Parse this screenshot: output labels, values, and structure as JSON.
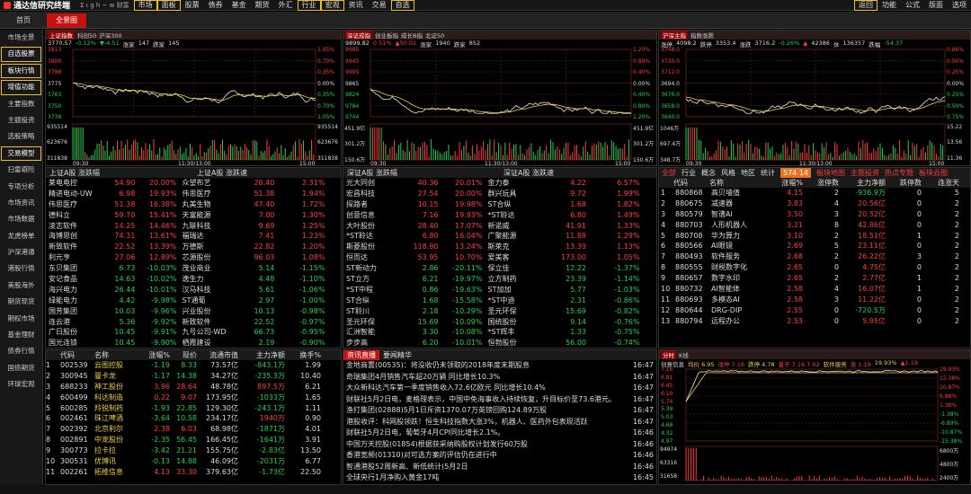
{
  "topbar": {
    "app": "通达信研究终端",
    "logo_text": "Σ ι g h ~ w 财富",
    "menu": [
      "市场",
      "面板",
      "股票",
      "债券",
      "基金",
      "期货",
      "外汇",
      "行业",
      "宏观",
      "资讯",
      "交易",
      "自选"
    ],
    "right_menu": [
      "返回",
      "功能",
      "公式",
      "版面",
      "选项"
    ]
  },
  "tabs": [
    "首页",
    "全景图"
  ],
  "sidebar": [
    "市场全景",
    "自选股票",
    "板块行情",
    "增值功能",
    "主要指数",
    "主题投资",
    "选股策略",
    "交易模型",
    "扫雷避险",
    "专项分析",
    "市场资讯",
    "市场数据",
    "龙虎榜单",
    "沪深港通",
    "港股行情",
    "美股海外",
    "期货现货",
    "期权市场",
    "基金理财",
    "债券行情",
    "国债期货",
    "环球宏观"
  ],
  "indices": [
    {
      "tabs": [
        "上证指数",
        "科创50",
        "沪深300"
      ],
      "info": [
        "3770.57",
        "-0.12%",
        "▼-4.51",
        "涨家",
        "147",
        "跌家",
        "145"
      ],
      "left_ticks": [
        "3813",
        "3800",
        "3788",
        "3775",
        "3763",
        "3750",
        "3738"
      ],
      "right_ticks": [
        "1.05%",
        "0.70%",
        "0.35%",
        "0.00%",
        "0.35%",
        "0.70%",
        "1.05%"
      ],
      "vol_left": [
        "935514",
        "623676",
        "311838"
      ],
      "vol_right": [
        "935514",
        "623676",
        "311838"
      ],
      "x_ticks": [
        "09:30",
        "11:30/13:00",
        "15:00"
      ]
    },
    {
      "tabs": [
        "深证成指",
        "创业板指",
        "成长B指",
        "北证50"
      ],
      "info": [
        "9899.82",
        "0.51%",
        "▲50.02",
        "涨家",
        "1940",
        "跌家",
        "852"
      ],
      "left_ticks": [
        "9985",
        "9945",
        "9905",
        "9865",
        "9824",
        "9784",
        "9744"
      ],
      "right_ticks": [
        "1.20%",
        "0.80%",
        "0.40%",
        "0.00%",
        "0.40%",
        "0.80%",
        "1.20%"
      ],
      "vol_left": [
        "451.9亿",
        "301.2万",
        "150.6万"
      ],
      "vol_right": [
        "451.9亿",
        "301.2万",
        "150.6万"
      ],
      "x_ticks": [
        "09:30",
        "11:30/13:00",
        "15:00"
      ]
    },
    {
      "tabs": [
        "沪深主指",
        "指数涨跌"
      ],
      "info": [
        "涨停",
        "4098.2",
        "跌停",
        "3353.4",
        "涨跌",
        "3716.2",
        "-0.26%",
        "▲",
        "42386",
        "休",
        "136357",
        "跌幅",
        "-54.37"
      ],
      "left_ticks": [
        "3748.0",
        "3730.0",
        "3712.0",
        "3694.0",
        "3676.0",
        "3658.0",
        "3640.0"
      ],
      "right_ticks": [
        "0.86%",
        "0.50%",
        "0.25%",
        "0.00%",
        "0.25%",
        "0.50%",
        "0.75%"
      ],
      "vol_left": [
        "1046万",
        "697.4万",
        "348.7万"
      ],
      "vol_right": [
        "15.22",
        "13.56",
        "11.36"
      ],
      "x_ticks": [
        "09:30",
        "11:30/13:00",
        "15:00"
      ]
    }
  ],
  "rank_sh": {
    "headers": [
      "上证A股 涨跌幅",
      "上证A股 涨跌速"
    ],
    "rows": [
      [
        "莱电电控",
        "54.90",
        "20.00%",
        "众望布艺",
        "20.40",
        "2.31%"
      ],
      [
        "精进电动-UW",
        "6.98",
        "19.93%",
        "伟思医疗",
        "51.38",
        "1.94%"
      ],
      [
        "伟思医疗",
        "51.38",
        "16.38%",
        "丸美生物",
        "47.40",
        "1.72%"
      ],
      [
        "德科立",
        "59.70",
        "15.41%",
        "天富能源",
        "7.00",
        "1.30%"
      ],
      [
        "凌志软件",
        "14.25",
        "14.46%",
        "九联科技",
        "9.69",
        "1.25%"
      ],
      [
        "海博思创",
        "74.31",
        "13.61%",
        "福瑞达",
        "7.41",
        "1.23%"
      ],
      [
        "新致软件",
        "22.52",
        "13.39%",
        "万德斯",
        "22.82",
        "1.20%"
      ],
      [
        "利元亨",
        "27.06",
        "12.89%",
        "芯源股份",
        "96.03",
        "1.08%"
      ],
      [
        "东贝集团",
        "6.73",
        "-10.03%",
        "茂业商业",
        "5.14",
        "-1.15%"
      ],
      [
        "安记食品",
        "14.63",
        "-10.02%",
        "逸生力",
        "4.48",
        "-1.10%"
      ],
      [
        "海兴电力",
        "26.44",
        "-10.01%",
        "汉马科技",
        "5.61",
        "-1.06%"
      ],
      [
        "绿能电力",
        "4.42",
        "-9.98%",
        "ST通葡",
        "2.97",
        "-1.00%"
      ],
      [
        "国芳集团",
        "10.03",
        "-9.96%",
        "兴业股份",
        "10.13",
        "-0.98%"
      ],
      [
        "连云港",
        "5.36",
        "-9.92%",
        "新致软件",
        "22.52",
        "-0.97%"
      ],
      [
        "广日股份",
        "10.45",
        "-9.91%",
        "九号公司-WD",
        "66.73",
        "-0.95%"
      ],
      [
        "国光连锁",
        "10.45",
        "-9.90%",
        "栖霞建设",
        "2.19",
        "-0.90%"
      ]
    ]
  },
  "rank_sz": {
    "headers": [
      "深证A股 涨跌幅",
      "深证A股 涨跌速"
    ],
    "rows": [
      [
        "光大同创",
        "40.36",
        "20.01%",
        "金力泰",
        "4.22",
        "6.57%"
      ],
      [
        "宏昌科技",
        "27.54",
        "20.00%",
        "群兴玩具",
        "9.72",
        "1.99%"
      ],
      [
        "探路者",
        "10.15",
        "19.98%",
        "ST合纵",
        "1.68",
        "1.82%"
      ],
      [
        "创意信息",
        "7.16",
        "19.93%",
        "*ST聆达",
        "6.80",
        "1.49%"
      ],
      [
        "大叶股份",
        "28.40",
        "17.07%",
        "新诺威",
        "41.91",
        "1.33%"
      ],
      [
        "*ST聆达",
        "6.80",
        "16.04%",
        "广聚能源",
        "11.88",
        "1.29%"
      ],
      [
        "斯菱股份",
        "118.90",
        "13.24%",
        "斯莱克",
        "13.39",
        "1.13%"
      ],
      [
        "恒而达",
        "53.95",
        "10.70%",
        "爱美客",
        "173.00",
        "1.05%"
      ],
      [
        "ST新动力",
        "2.86",
        "-20.11%",
        "保立佳",
        "12.22",
        "-1.37%"
      ],
      [
        "ST立方",
        "6.21",
        "-19.97%",
        "立方制药",
        "23.39",
        "-1.14%"
      ],
      [
        "*ST中程",
        "0.86",
        "-19.63%",
        "ST加加",
        "5.77",
        "-1.03%"
      ],
      [
        "ST合纵",
        "1.68",
        "-15.58%",
        "*ST中迪",
        "2.31",
        "-0.86%"
      ],
      [
        "ST聆川",
        "2.18",
        "-10.29%",
        "圣元环保",
        "15.69",
        "-0.82%"
      ],
      [
        "圣元环保",
        "15.69",
        "-10.09%",
        "国统股份",
        "9.14",
        "-0.76%"
      ],
      [
        "汇洲智能",
        "3.30",
        "-10.08%",
        "*ST辉丰",
        "1.33",
        "-0.75%"
      ],
      [
        "步步高",
        "6.20",
        "-10.01%",
        "恒勃股份",
        "56.00",
        "-0.74%"
      ]
    ]
  },
  "sectors": {
    "tabs": [
      "全部",
      "行业",
      "概念",
      "风格",
      "地区",
      "统计"
    ],
    "badge": "574 14",
    "right_tabs": [
      "板块地图",
      "主题投资",
      "热点专题",
      "板块云图"
    ],
    "headers": [
      "代码",
      "名称",
      "涨幅%",
      "涨停数",
      "主力净额",
      "跌停数",
      "连涨天"
    ],
    "rows": [
      [
        "1",
        "880868",
        "高贝墙值",
        "4.15",
        "2",
        "-936.9万",
        "0",
        "5"
      ],
      [
        "2",
        "880675",
        "减速器",
        "3.83",
        "4",
        "20.56亿",
        "0",
        "2"
      ],
      [
        "3",
        "880579",
        "智谱AI",
        "3.50",
        "3",
        "20.52亿",
        "0",
        "2"
      ],
      [
        "4",
        "880703",
        "人形机器人",
        "3.21",
        "8",
        "42.86亿",
        "0",
        "2"
      ],
      [
        "5",
        "880708",
        "华为算力",
        "3.10",
        "2",
        "18.51亿",
        "1",
        "2"
      ],
      [
        "6",
        "880566",
        "AI眼镜",
        "2.69",
        "5",
        "23.11亿",
        "0",
        "2"
      ],
      [
        "7",
        "880493",
        "软件服务",
        "2.68",
        "2",
        "26.22亿",
        "3",
        "2"
      ],
      [
        "8",
        "880555",
        "财税数字化",
        "2.65",
        "0",
        "4.75亿",
        "0",
        "2"
      ],
      [
        "9",
        "880657",
        "数字水印",
        "2.65",
        "2",
        "2.77亿",
        "1",
        "2"
      ],
      [
        "10",
        "880732",
        "AI智能体",
        "2.58",
        "4",
        "16.07亿",
        "1",
        "2"
      ],
      [
        "11",
        "880693",
        "多模态AI",
        "2.58",
        "3",
        "11.22亿",
        "0",
        "2"
      ],
      [
        "12",
        "880644",
        "DRG-DIP",
        "2.55",
        "0",
        "-720.5万",
        "0",
        "2"
      ],
      [
        "13",
        "880794",
        "远程办公",
        "2.53",
        "0",
        "5.95亿",
        "0",
        "2"
      ]
    ]
  },
  "watchlist": {
    "headers": [
      "",
      "代码",
      "名称",
      "涨幅%",
      "现价",
      "流通市值",
      "主力净额",
      "换手%"
    ],
    "rows": [
      [
        "1",
        "002539",
        "云图控股",
        "-1.19",
        "8.33",
        "73.57亿",
        "-843.1万",
        "1.99"
      ],
      [
        "2",
        "300945",
        "曼卡龙",
        "-1.17",
        "14.38",
        "34.27亿",
        "-235.3万",
        "10.40"
      ],
      [
        "3",
        "688233",
        "神工股份",
        "3.96",
        "28.64",
        "48.78亿",
        "897.5万",
        "6.21"
      ],
      [
        "4",
        "600499",
        "科达制造",
        "0.22",
        "9.07",
        "173.95亿",
        "-1033万",
        "1.65"
      ],
      [
        "5",
        "600285",
        "羚锐制药",
        "-1.93",
        "22.85",
        "129.30亿",
        "-243.1万",
        "1.11"
      ],
      [
        "6",
        "002461",
        "珠江啤酒",
        "-3.64",
        "10.58",
        "234.17亿",
        "1940万",
        "0.90"
      ],
      [
        "7",
        "002392",
        "北京利尔",
        "2.38",
        "6.03",
        "68.98亿",
        "-1871万",
        "4.01"
      ],
      [
        "8",
        "002891",
        "中宠股份",
        "-2.35",
        "56.45",
        "166.45亿",
        "-1641万",
        "3.91"
      ],
      [
        "9",
        "300773",
        "拉卡拉",
        "-3.42",
        "21.21",
        "155.75亿",
        "-2.83亿",
        "13.50"
      ],
      [
        "10",
        "300531",
        "优博讯",
        "-0.13",
        "14.88",
        "46.09亿",
        "-2031万",
        "6.77"
      ],
      [
        "11",
        "002261",
        "拓维信息",
        "4.13",
        "33.30",
        "379.63亿",
        "-1.73亿",
        "22.50"
      ]
    ]
  },
  "news": {
    "tabs": [
      "资讯直播",
      "要闻精华"
    ],
    "items": [
      [
        "金地商置(00535)：将没收仍未领取的2018年度末期股息",
        "16:47"
      ],
      [
        "奇瑞集团4月销售汽车超20万辆 同比增长10.3%",
        "16:47"
      ],
      [
        "大众新科达汽车第一季度销售收入72.6亿欧元 同比增长10.4%",
        "16:47"
      ],
      [
        "财联社5月2日电，麦格理表示，中国中免海事收入持续恢复，升目标价至73.6港元。",
        "16:47"
      ],
      [
        "渔打集团(02888)5月1日斥资1370.07万英镑回购124.89万股",
        "16:47"
      ],
      [
        "港股收评：科网股领跌！恒生科技指数大涨3%，机器人、医药外包表现活跃",
        "16:47"
      ],
      [
        "财联社5月2日电，葡萄牙4月CPI同比增长2.1%。",
        "16:46"
      ],
      [
        "中国万天控股(01854)根据获采纳购股权计划发行60万股",
        "16:46"
      ],
      [
        "香港宽频(01310)对可选方案的评估仍在进行中",
        "16:46"
      ],
      [
        "智通港股52周新高、新低统计(5月2日",
        "16:46"
      ],
      [
        "全球央行1月净购入黄金17吨",
        "16:45"
      ]
    ]
  },
  "mini": {
    "tabs": [
      "分时",
      "K线"
    ],
    "info": [
      "创意信息",
      "均价 6.95",
      "涨停 7.16",
      "跌停 4.78",
      "量子 7.16 7.02",
      "软件服务",
      "涨 1.19",
      "19.93%",
      "▲1.19"
    ],
    "left_ticks": [
      "7.16",
      "6.81",
      "6.45",
      "6.10",
      "5.74",
      "5.39",
      "5.03",
      "4.68",
      "4.32",
      "4.97"
    ],
    "right_ticks": [
      "19.93%",
      "15.38%",
      "10.87%",
      "6.88%",
      "1.38%",
      "-1.38%",
      "-6.89%",
      "-10.87%",
      "-15.38%"
    ],
    "vol_left": [
      "94974",
      "63316",
      "31658"
    ],
    "vol_right": [
      "6800万",
      "4800万",
      "2400万"
    ]
  },
  "colors": {
    "up": "#ff3b3b",
    "down": "#1fd14a",
    "accent": "#f0c020",
    "tab_active": "#c81010"
  }
}
